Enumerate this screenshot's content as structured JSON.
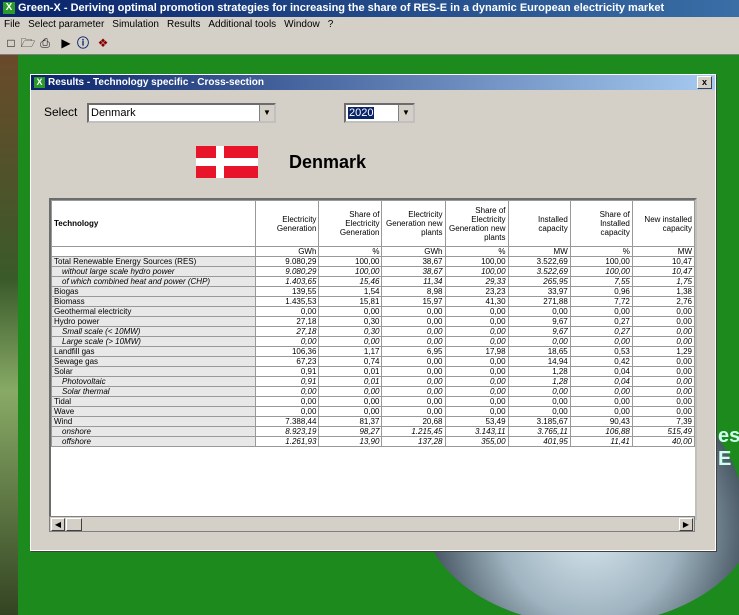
{
  "app": {
    "title": "Green-X - Deriving optimal promotion strategies for increasing the share of RES-E in a dynamic European electricity market",
    "icon": "green-x-icon",
    "menu": [
      "File",
      "Select parameter",
      "Simulation",
      "Results",
      "Additional tools",
      "Window",
      "?"
    ],
    "toolbar": [
      "new-document-icon",
      "open-folder-icon",
      "print-icon",
      "run-icon",
      "info-icon",
      "settings-icon"
    ]
  },
  "dialog": {
    "title": "Results - Technology specific - Cross-section",
    "close_label": "x",
    "select_label": "Select",
    "country_value": "Denmark",
    "year_value": "2020",
    "country_heading": "Denmark"
  },
  "table": {
    "tech_header": "Technology",
    "columns": [
      {
        "header": "Electricity Generation",
        "unit": "GWh"
      },
      {
        "header": "Share of Electricity Generation",
        "unit": "%"
      },
      {
        "header": "Electricity Generation new plants",
        "unit": "GWh"
      },
      {
        "header": "Share of Electricity Generation new plants",
        "unit": "%"
      },
      {
        "header": "Installed capacity",
        "unit": "MW"
      },
      {
        "header": "Share of Installed capacity",
        "unit": "%"
      },
      {
        "header": "New installed capacity",
        "unit": "MW"
      }
    ],
    "rows": [
      {
        "name": "Total Renewable Energy Sources (RES)",
        "sub": false,
        "values": [
          "9.080,29",
          "100,00",
          "38,67",
          "100,00",
          "3.522,69",
          "100,00",
          "10,47"
        ]
      },
      {
        "name": "without large scale hydro power",
        "sub": true,
        "values": [
          "9.080,29",
          "100,00",
          "38,67",
          "100,00",
          "3.522,69",
          "100,00",
          "10,47"
        ]
      },
      {
        "name": "of which combined heat and power (CHP)",
        "sub": true,
        "values": [
          "1.403,65",
          "15,46",
          "11,34",
          "29,33",
          "265,95",
          "7,55",
          "1,75"
        ]
      },
      {
        "name": "Biogas",
        "sub": false,
        "values": [
          "139,55",
          "1,54",
          "8,98",
          "23,23",
          "33,97",
          "0,96",
          "1,38"
        ]
      },
      {
        "name": "Biomass",
        "sub": false,
        "values": [
          "1.435,53",
          "15,81",
          "15,97",
          "41,30",
          "271,88",
          "7,72",
          "2,76"
        ]
      },
      {
        "name": "Geothermal electricity",
        "sub": false,
        "values": [
          "0,00",
          "0,00",
          "0,00",
          "0,00",
          "0,00",
          "0,00",
          "0,00"
        ]
      },
      {
        "name": "Hydro power",
        "sub": false,
        "values": [
          "27,18",
          "0,30",
          "0,00",
          "0,00",
          "9,67",
          "0,27",
          "0,00"
        ]
      },
      {
        "name": "Small scale (< 10MW)",
        "sub": true,
        "values": [
          "27,18",
          "0,30",
          "0,00",
          "0,00",
          "9,67",
          "0,27",
          "0,00"
        ]
      },
      {
        "name": "Large scale (> 10MW)",
        "sub": true,
        "values": [
          "0,00",
          "0,00",
          "0,00",
          "0,00",
          "0,00",
          "0,00",
          "0,00"
        ]
      },
      {
        "name": "Landfill gas",
        "sub": false,
        "values": [
          "106,36",
          "1,17",
          "6,95",
          "17,98",
          "18,65",
          "0,53",
          "1,29"
        ]
      },
      {
        "name": "Sewage gas",
        "sub": false,
        "values": [
          "67,23",
          "0,74",
          "0,00",
          "0,00",
          "14,94",
          "0,42",
          "0,00"
        ]
      },
      {
        "name": "Solar",
        "sub": false,
        "values": [
          "0,91",
          "0,01",
          "0,00",
          "0,00",
          "1,28",
          "0,04",
          "0,00"
        ]
      },
      {
        "name": "Photovoltaic",
        "sub": true,
        "values": [
          "0,91",
          "0,01",
          "0,00",
          "0,00",
          "1,28",
          "0,04",
          "0,00"
        ]
      },
      {
        "name": "Solar thermal",
        "sub": true,
        "values": [
          "0,00",
          "0,00",
          "0,00",
          "0,00",
          "0,00",
          "0,00",
          "0,00"
        ]
      },
      {
        "name": "Tidal",
        "sub": false,
        "values": [
          "0,00",
          "0,00",
          "0,00",
          "0,00",
          "0,00",
          "0,00",
          "0,00"
        ]
      },
      {
        "name": "Wave",
        "sub": false,
        "values": [
          "0,00",
          "0,00",
          "0,00",
          "0,00",
          "0,00",
          "0,00",
          "0,00"
        ]
      },
      {
        "name": "Wind",
        "sub": false,
        "values": [
          "7.388,44",
          "81,37",
          "20,68",
          "53,49",
          "3.185,67",
          "90,43",
          "7,39"
        ]
      },
      {
        "name": "onshore",
        "sub": true,
        "values": [
          "8.923,19",
          "98,27",
          "1.215,45",
          "3.143,11",
          "3.765,11",
          "106,88",
          "515,49"
        ]
      },
      {
        "name": "offshore",
        "sub": true,
        "values": [
          "1.261,93",
          "13,90",
          "137,28",
          "355,00",
          "401,95",
          "11,41",
          "40,00"
        ]
      }
    ]
  },
  "background": {
    "partial_text": "es\nE"
  },
  "colors": {
    "titlebar": "#0a246a",
    "desktop_green": "#1c8a1c",
    "window_face": "#d4d0c8",
    "flag_red": "#e8142a"
  }
}
